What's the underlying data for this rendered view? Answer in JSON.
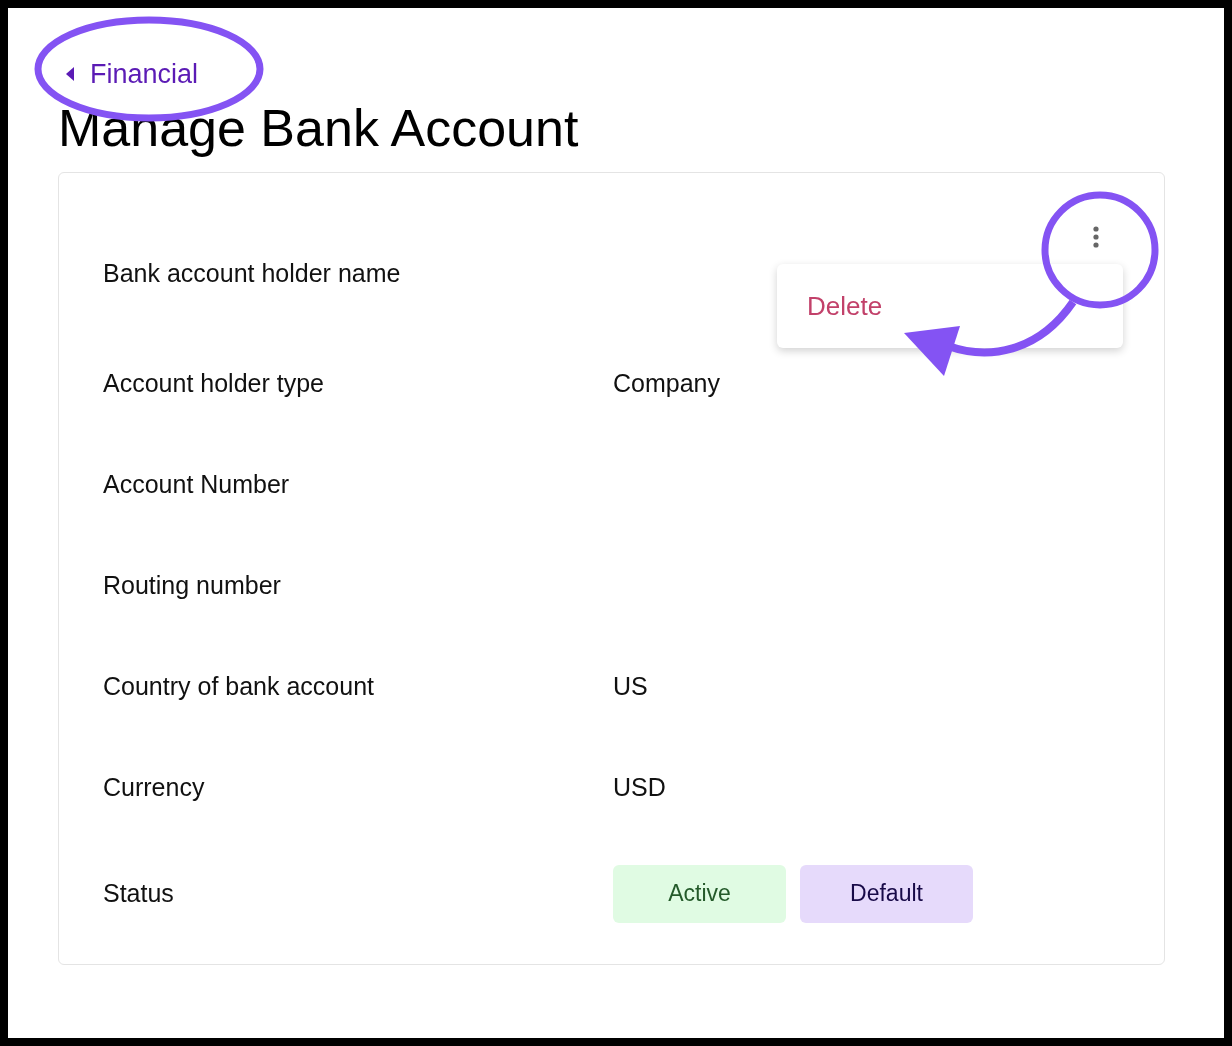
{
  "back_link": {
    "label": "Financial"
  },
  "title": "Manage Bank Account",
  "actions_menu": {
    "expanded": true,
    "items": [
      {
        "label": "Delete",
        "kind": "danger"
      }
    ]
  },
  "fields": [
    {
      "label": "Bank account holder name"
    },
    {
      "label": "Account holder type",
      "value": "Company"
    },
    {
      "label": "Account Number"
    },
    {
      "label": "Routing number"
    },
    {
      "label": "Country of bank account",
      "value": "US"
    },
    {
      "label": "Currency",
      "value": "USD"
    },
    {
      "label": "Status",
      "badges": [
        {
          "label": "Active",
          "color": "#e0fbe3"
        },
        {
          "label": "Default",
          "color": "#e6dafb"
        }
      ]
    }
  ]
}
